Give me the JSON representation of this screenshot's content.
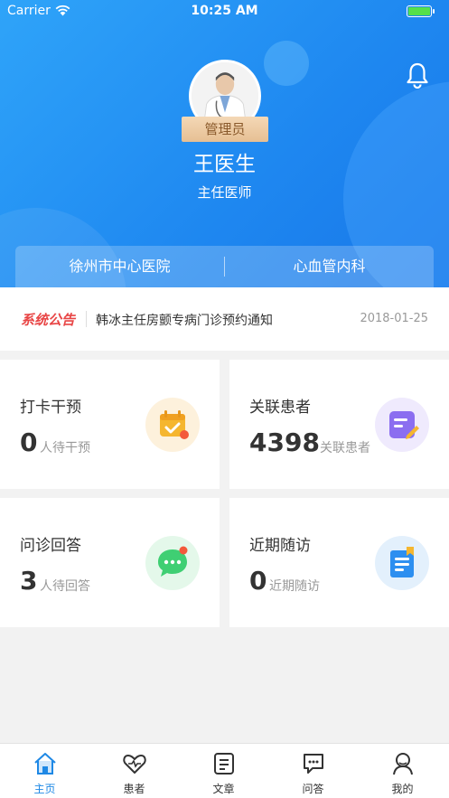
{
  "status_bar": {
    "carrier": "Carrier",
    "time": "10:25 AM"
  },
  "profile": {
    "role": "管理员",
    "name": "王医生",
    "title": "主任医师"
  },
  "org": {
    "hospital": "徐州市中心医院",
    "department": "心血管内科"
  },
  "notice": {
    "tag": "系统公告",
    "text": "韩冰主任房颤专病门诊预约通知",
    "date": "2018-01-25"
  },
  "cards": [
    {
      "title": "打卡干预",
      "count": "0",
      "sub": "人待干预",
      "icon": "calendar-check-icon",
      "color": "#f5b62f"
    },
    {
      "title": "关联患者",
      "count": "4398",
      "sub": "关联患者",
      "icon": "edit-note-icon",
      "color": "#8b6ef0"
    },
    {
      "title": "问诊回答",
      "count": "3",
      "sub": "人待回答",
      "icon": "chat-bubble-icon",
      "color": "#3fcf73"
    },
    {
      "title": "近期随访",
      "count": "0",
      "sub": "近期随访",
      "icon": "followup-doc-icon",
      "color": "#2d8ff0"
    }
  ],
  "tabs": [
    {
      "label": "主页",
      "icon": "home-icon",
      "active": true
    },
    {
      "label": "患者",
      "icon": "heart-pulse-icon"
    },
    {
      "label": "文章",
      "icon": "article-icon"
    },
    {
      "label": "问答",
      "icon": "chat-icon"
    },
    {
      "label": "我的",
      "icon": "profile-icon"
    }
  ],
  "colors": {
    "primary": "#1e88e5",
    "accent_red": "#e84545"
  }
}
